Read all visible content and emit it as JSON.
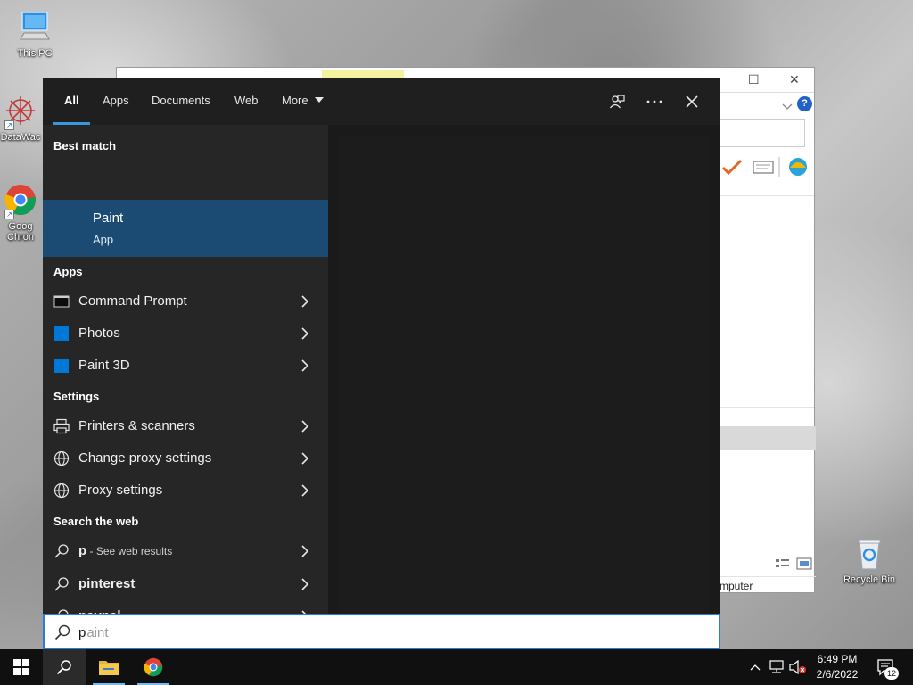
{
  "desktop": {
    "icons": {
      "this_pc": "This PC",
      "datawac": "DataWac",
      "chrome_line1": "Goog",
      "chrome_line2": "Chron",
      "recycle_bin": "Recycle Bin"
    }
  },
  "background_window": {
    "status_text": "mputer",
    "help_label": "?"
  },
  "search": {
    "tabs": [
      "All",
      "Apps",
      "Documents",
      "Web",
      "More"
    ],
    "active_tab": "All",
    "best_match": {
      "heading": "Best match",
      "title": "Paint",
      "subtitle": "App"
    },
    "apps": {
      "heading": "Apps",
      "items": [
        "Command Prompt",
        "Photos",
        "Paint 3D"
      ]
    },
    "settings": {
      "heading": "Settings",
      "items": [
        "Printers & scanners",
        "Change proxy settings",
        "Proxy settings"
      ]
    },
    "web": {
      "heading": "Search the web",
      "first_query": "p",
      "first_suffix": " - See web results",
      "items": [
        "pinterest",
        "paypal"
      ]
    },
    "query": {
      "typed": "p",
      "suggestion_rest": "aint"
    }
  },
  "taskbar": {
    "time": "6:49 PM",
    "date": "2/6/2022",
    "notification_count": "12"
  },
  "colors": {
    "accent": "#3a96dd",
    "selected": "#1b4a73",
    "panel": "#262626",
    "taskbar": "#101010"
  }
}
